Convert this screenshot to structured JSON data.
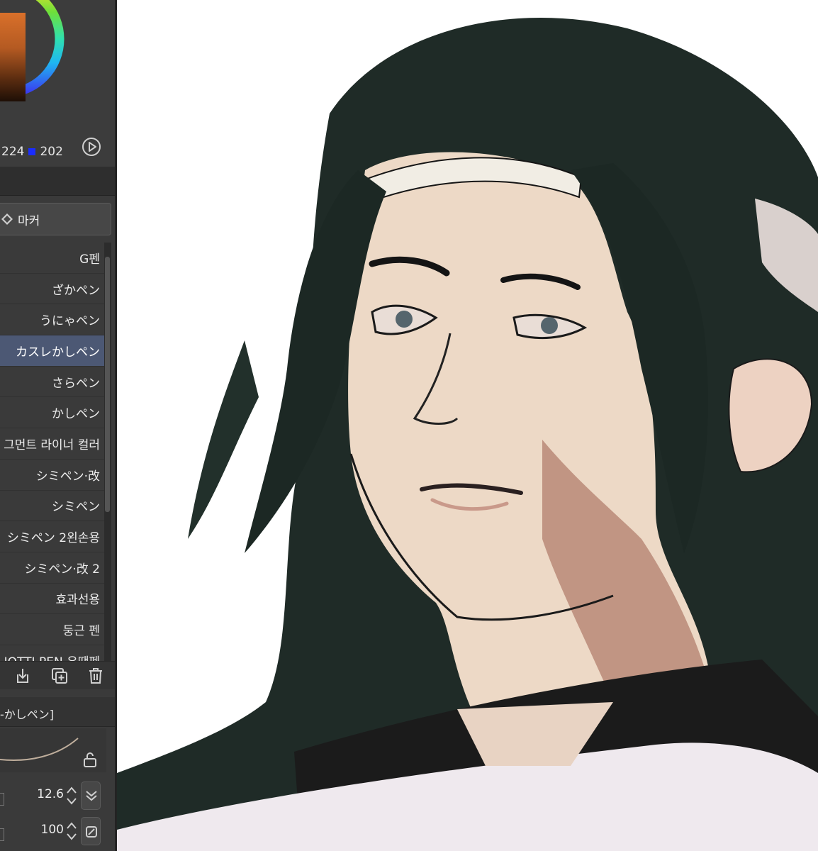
{
  "color_panel": {
    "g_value": "224",
    "b_value": "202",
    "icons": {
      "play": "play-circle-icon"
    },
    "colors": {
      "current_color": "#d9702a",
      "blue_marker": "#1a2cff"
    }
  },
  "tool_group": {
    "label": "마커",
    "icon": "marker-icon"
  },
  "brushes": [
    {
      "label": "G펜"
    },
    {
      "label": "ざかペン"
    },
    {
      "label": "うにゃペン"
    },
    {
      "label": "カスレかしペン",
      "active": true
    },
    {
      "label": "さらペン"
    },
    {
      "label": "かしペン"
    },
    {
      "label": "그먼트 라이너 컬러"
    },
    {
      "label": "シミペン·改"
    },
    {
      "label": "シミペン"
    },
    {
      "label": "シミペン 2왼손용"
    },
    {
      "label": "シミペン·改 2"
    },
    {
      "label": "효과선용"
    },
    {
      "label": "둥근 펜"
    },
    {
      "label": "IOTTI PEN 우땐펜"
    }
  ],
  "brush_actions": {
    "icons": [
      "import-icon",
      "duplicate-icon",
      "trash-icon"
    ]
  },
  "sub_tool": {
    "label": "-かしペン]"
  },
  "properties": {
    "size_value": "12.6",
    "opacity_value": "100",
    "icons": [
      "lock-icon",
      "pressure-icon",
      "blend-icon"
    ]
  },
  "theme": {
    "panel_bg": "#3a3a3a",
    "active_item": "#4c5874",
    "canvas_bg": "#ffffff"
  }
}
